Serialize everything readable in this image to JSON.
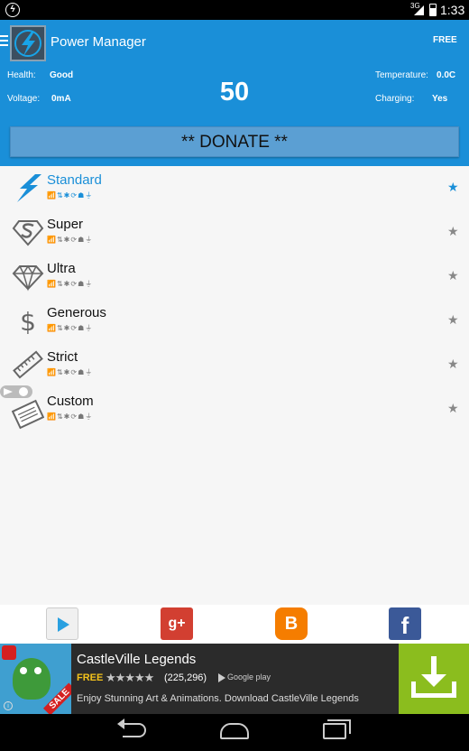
{
  "status_bar": {
    "network": "3G",
    "time": "1:33"
  },
  "header": {
    "title": "Power Manager",
    "badge": "FREE",
    "battery_level": "50",
    "stats": {
      "health_label": "Health:",
      "health_value": "Good",
      "voltage_label": "Voltage:",
      "voltage_value": "0mA",
      "temperature_label": "Temperature:",
      "temperature_value": "0.0C",
      "charging_label": "Charging:",
      "charging_value": "Yes"
    },
    "donate_label": "** DONATE **"
  },
  "profiles": [
    {
      "name": "Standard",
      "icon": "lightning-icon",
      "active": true
    },
    {
      "name": "Super",
      "icon": "superman-shield-icon",
      "active": false
    },
    {
      "name": "Ultra",
      "icon": "diamond-icon",
      "active": false
    },
    {
      "name": "Generous",
      "icon": "dollar-icon",
      "active": false
    },
    {
      "name": "Strict",
      "icon": "ruler-icon",
      "active": false
    },
    {
      "name": "Custom",
      "icon": "notepad-icon",
      "active": false
    }
  ],
  "feature_icons": "📶⇅✱⟳☗⏚",
  "share": [
    "play-store-icon",
    "google-plus-icon",
    "blogger-icon",
    "facebook-icon"
  ],
  "share_labels": {
    "gplus": "g+",
    "blogger": "B",
    "facebook": "f"
  },
  "ad": {
    "title": "CastleVille Legends",
    "price": "FREE",
    "stars": "★★★★★",
    "rating_count": "(225,296)",
    "store": "Google play",
    "sale": "SALE",
    "description": "Enjoy Stunning Art & Animations. Download CastleVille Legends"
  },
  "colors": {
    "accent": "#1a8fd8",
    "donate": "#5b9fd3",
    "ad_download": "#8bbd1e"
  }
}
